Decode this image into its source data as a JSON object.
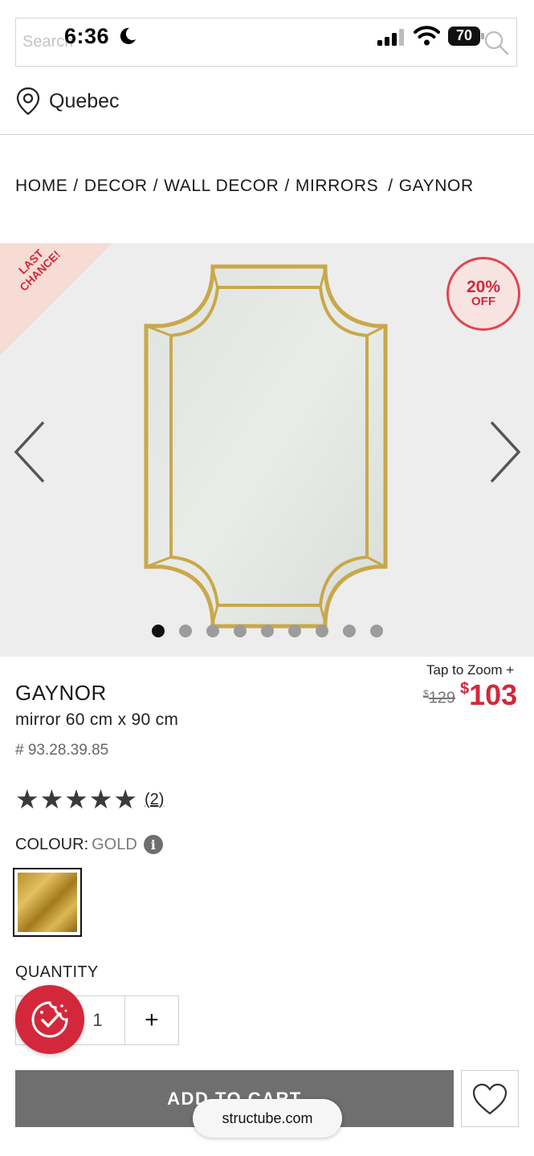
{
  "status_bar": {
    "time": "6:36",
    "battery": "70"
  },
  "search": {
    "placeholder": "Search"
  },
  "location": {
    "label": "Quebec"
  },
  "breadcrumb": [
    "HOME",
    "DECOR",
    "WALL DECOR",
    "MIRRORS",
    "GAYNOR"
  ],
  "gallery": {
    "ribbon": "LAST CHANCE!",
    "discount_pct": "20%",
    "discount_off": "OFF",
    "dot_count": 9,
    "active_dot": 0
  },
  "product": {
    "tap_zoom": "Tap to Zoom +",
    "price_old_currency": "$",
    "price_old": "129",
    "price_new_currency": "$",
    "price_new": "103",
    "name": "GAYNOR",
    "description": "mirror 60 cm x 90 cm",
    "sku": "# 93.28.39.85",
    "rating": 5,
    "review_count": "(2)",
    "colour_label": "COLOUR:",
    "colour_value": "GOLD",
    "quantity_label": "QUANTITY",
    "quantity_value": "1",
    "quantity_plus": "+"
  },
  "actions": {
    "add_to_cart": "ADD TO CART"
  },
  "browser": {
    "url": "structube.com"
  },
  "colors": {
    "accent_red": "#d3283b",
    "button_gray": "#6f6f6f",
    "gallery_bg": "#ededed"
  }
}
